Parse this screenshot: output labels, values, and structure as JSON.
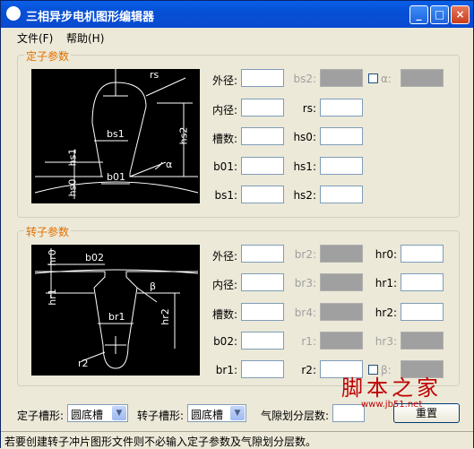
{
  "window": {
    "title": "三相异步电机图形编辑器"
  },
  "menu": {
    "file": "文件(F)",
    "help": "帮助(H)"
  },
  "stator": {
    "group_title": "定子参数",
    "labels": {
      "outer": "外径:",
      "inner": "内径:",
      "slots": "槽数:",
      "b01": "b01:",
      "bs1": "bs1:",
      "bs2": "bs2:",
      "rs": "rs:",
      "hs0": "hs0:",
      "hs1": "hs1:",
      "hs2": "hs2:",
      "alpha": "α:"
    },
    "diagram": {
      "rs": "rs",
      "bs1": "bs1",
      "hs2": "hs2",
      "hs1": "hs1",
      "alpha": "α",
      "hs0": "hs0",
      "b01": "b01"
    }
  },
  "rotor": {
    "group_title": "转子参数",
    "labels": {
      "outer": "外径:",
      "inner": "内径:",
      "slots": "槽数:",
      "b02": "b02:",
      "br1": "br1:",
      "br2": "br2:",
      "br3": "br3:",
      "br4": "br4:",
      "r1": "r1:",
      "r2": "r2:",
      "hr0": "hr0:",
      "hr1": "hr1:",
      "hr2": "hr2:",
      "hr3": "hr3:",
      "beta": "β:"
    },
    "diagram": {
      "hr0": "hr0",
      "b02": "b02",
      "hr1": "hr1",
      "beta": "β",
      "br1": "br1",
      "hr2": "hr2",
      "r2": "r2"
    }
  },
  "bottom": {
    "stator_slot_label": "定子槽形:",
    "stator_slot_value": "圆底槽",
    "rotor_slot_label": "转子槽形:",
    "rotor_slot_value": "圆底槽",
    "gap_layers_label": "气隙划分层数:",
    "reset_button": "重置"
  },
  "status": "若要创建转子冲片图形文件则不必输入定子参数及气隙划分层数。",
  "watermark": {
    "main": "脚本之家",
    "sub": "www.jb51.net"
  }
}
